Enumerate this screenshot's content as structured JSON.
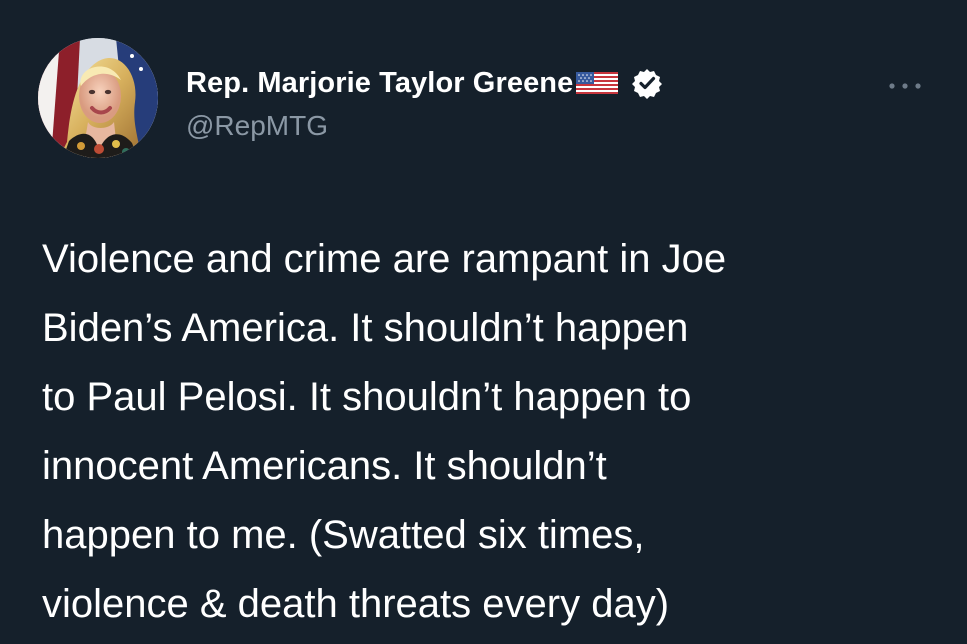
{
  "tweet": {
    "author": {
      "display_name": "Rep. Marjorie Taylor Greene",
      "handle": "@RepMTG",
      "avatar_icon": "profile-photo-avatar",
      "flag_icon": "us-flag-emoji-icon",
      "verified_icon": "verified-badge-icon"
    },
    "more_icon": "more-options-icon",
    "text": "Violence and crime are rampant in Joe\nBiden’s America. It shouldn’t happen\nto Paul Pelosi. It shouldn’t happen to\ninnocent Americans. It shouldn’t\nhappen to me. (Swatted six times,\nviolence & death threats every day)"
  },
  "colors": {
    "background": "#15202b",
    "primary_text": "#ffffff",
    "secondary_text": "#8b98a5",
    "verified_badge": "#ffffff"
  }
}
